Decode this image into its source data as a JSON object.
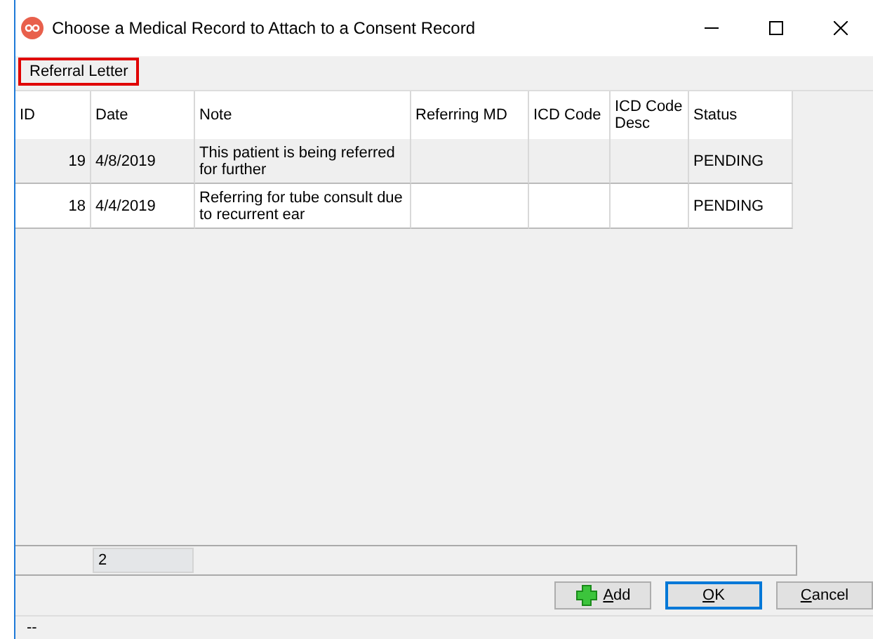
{
  "window": {
    "title": "Choose a Medical Record to Attach to a Consent Record"
  },
  "tabs": [
    {
      "label": "Referral Letter",
      "selected": true
    }
  ],
  "table": {
    "columns": [
      "ID",
      "Date",
      "Note",
      "Referring MD",
      "ICD Code",
      "ICD Code Desc",
      "Status"
    ],
    "rows": [
      {
        "cells": [
          "19",
          "4/8/2019",
          "This patient is being referred for further",
          "",
          "",
          "",
          "PENDING"
        ],
        "selected": true
      },
      {
        "cells": [
          "18",
          "4/4/2019",
          "Referring for tube consult due to recurrent ear",
          "",
          "",
          "",
          "PENDING"
        ],
        "selected": false
      }
    ],
    "footer": {
      "count": "2"
    }
  },
  "buttons": [
    {
      "label": "Add",
      "kind": "add",
      "default": false
    },
    {
      "label": "OK",
      "kind": "plain",
      "default": true
    },
    {
      "label": "Cancel",
      "kind": "plain",
      "default": false
    }
  ],
  "status_bar": "--"
}
